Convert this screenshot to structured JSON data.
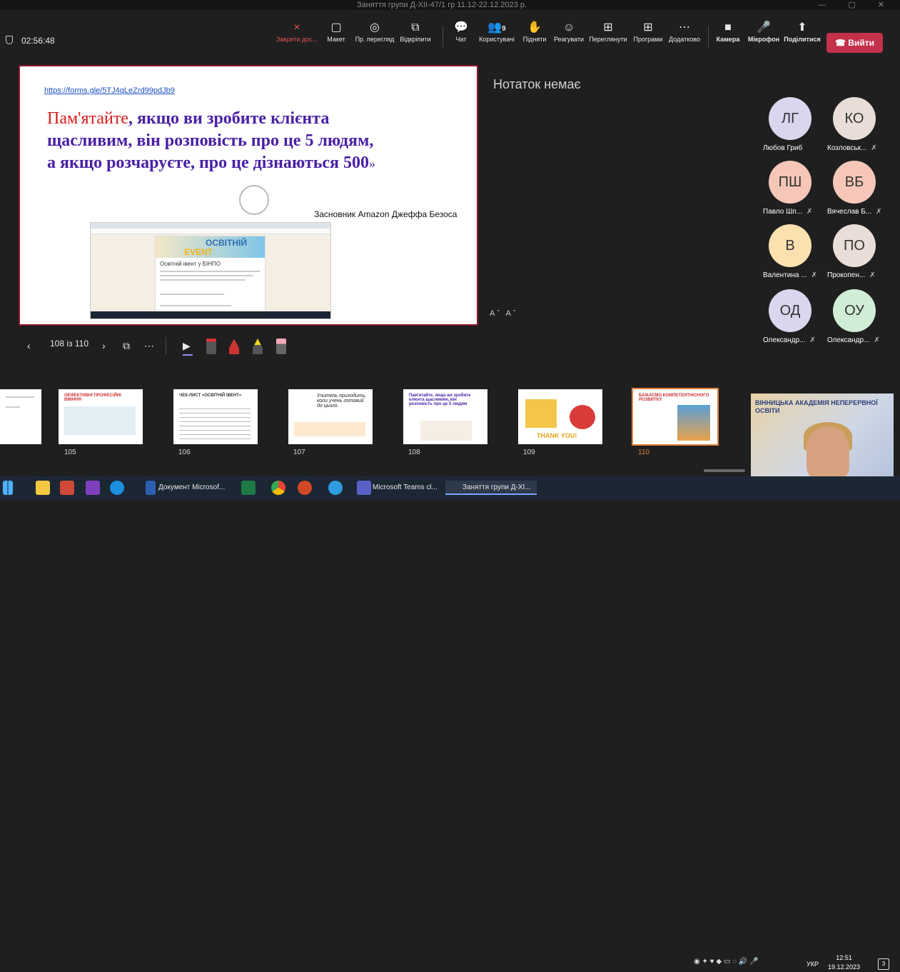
{
  "window": {
    "title": "Заняття групи Д-XII-47/1 гр 11.12-22.12.2023 р."
  },
  "meeting": {
    "timer": "02:56:48"
  },
  "toolbar": {
    "items": [
      {
        "id": "close-share",
        "label": "Закрити дос...",
        "icon": "×"
      },
      {
        "id": "layout",
        "label": "Макет",
        "icon": "▢"
      },
      {
        "id": "preview",
        "label": "Пр. перегляд",
        "icon": "◎"
      },
      {
        "id": "unpin",
        "label": "Відкріпити",
        "icon": "⧉"
      },
      {
        "id": "chat",
        "label": "Чат",
        "icon": "💬"
      },
      {
        "id": "people",
        "label": "Користувачі",
        "icon": "👥"
      },
      {
        "id": "raise",
        "label": "Підняти",
        "icon": "✋"
      },
      {
        "id": "react",
        "label": "Реагувати",
        "icon": "☺"
      },
      {
        "id": "view",
        "label": "Переглянути",
        "icon": "⊞"
      },
      {
        "id": "apps",
        "label": "Програми",
        "icon": "⊞"
      },
      {
        "id": "more",
        "label": "Додатково",
        "icon": "⋯"
      },
      {
        "id": "camera",
        "label": "Камера",
        "icon": "■"
      },
      {
        "id": "mic",
        "label": "Мікрофон",
        "icon": "🎤"
      },
      {
        "id": "share",
        "label": "Поділитися",
        "icon": "⬆"
      }
    ],
    "people_count": "9",
    "leave_label": "Вийти"
  },
  "slide": {
    "link": "https://forms.gle/5TJ4qLeZrd99pdJb9",
    "quote_red": "Пам'ятайте",
    "quote_main": ", якщо ви зробите клієнта щасливим, він розповість про це 5 людям,",
    "quote_second": " а якщо розчаруєте, про це дізнаються 500",
    "quote_end": "»",
    "author": "Засновник Amazon Джеффа Безоса",
    "embedded_banner_top": "ОСВІТНІЙ",
    "embedded_banner_bottom": "EVENT",
    "embedded_title": "Освітній івент у БІНПО"
  },
  "notes": {
    "empty_text": "Нотаток немає",
    "font_controls": "Aˆ Aˇ"
  },
  "participants": [
    {
      "initials": "ЛГ",
      "name": "Любов Гриб",
      "muted": false,
      "color": "#d9d6ee"
    },
    {
      "initials": "КО",
      "name": "Козловськ...",
      "muted": true,
      "color": "#e9ddd7"
    },
    {
      "initials": "ПШ",
      "name": "Павло Шп...",
      "muted": true,
      "color": "#f6c6b8"
    },
    {
      "initials": "ВБ",
      "name": "Вячеслав Б...",
      "muted": true,
      "color": "#f6c6b8"
    },
    {
      "initials": "В",
      "name": "Валентина ...",
      "muted": true,
      "color": "#fbe0b0"
    },
    {
      "initials": "ПО",
      "name": "Прокопен...",
      "muted": true,
      "color": "#e9ddd7"
    },
    {
      "initials": "ОД",
      "name": "Олександр...",
      "muted": true,
      "color": "#d9d6ee"
    },
    {
      "initials": "ОУ",
      "name": "Олександр...",
      "muted": true,
      "color": "#d1edd6"
    }
  ],
  "pager": {
    "text": "108 із 110",
    "prev": "‹",
    "next": "›",
    "more": "⋯"
  },
  "thumbnails": [
    {
      "num": "105",
      "title": "ОЕФЕКТИВНІ ПРОФЕСІЙНІ ВМІННЯ"
    },
    {
      "num": "106",
      "title": "ЧЕК-ЛИСТ «ОСВІТНІЙ ІВЕНТ»"
    },
    {
      "num": "107",
      "title": "Учитель приходить, коли учень готовий до цього."
    },
    {
      "num": "108",
      "title": "Пам'ятайте, якщо ви зробите клієнта щасливим, він розповість про це 5 людям"
    },
    {
      "num": "109",
      "title": "THANK YOU!"
    },
    {
      "num": "110",
      "title": "БАЖАЄМО КОМПЕТЕНТНІСНОГО РОЗВИТКУ"
    }
  ],
  "video": {
    "sign": "ВІННИЦЬКА АКАДЕМІЯ НЕПЕРЕРВНОЇ ОСВІТИ"
  },
  "taskbar": {
    "apps": [
      {
        "label": "Документ Microsof..."
      },
      {
        "label": "Microsoft Teams cl..."
      },
      {
        "label": "Заняття групи Д-XI..."
      }
    ],
    "lang": "УКР",
    "time": "12:51",
    "date": "19.12.2023",
    "notifications": "3"
  }
}
